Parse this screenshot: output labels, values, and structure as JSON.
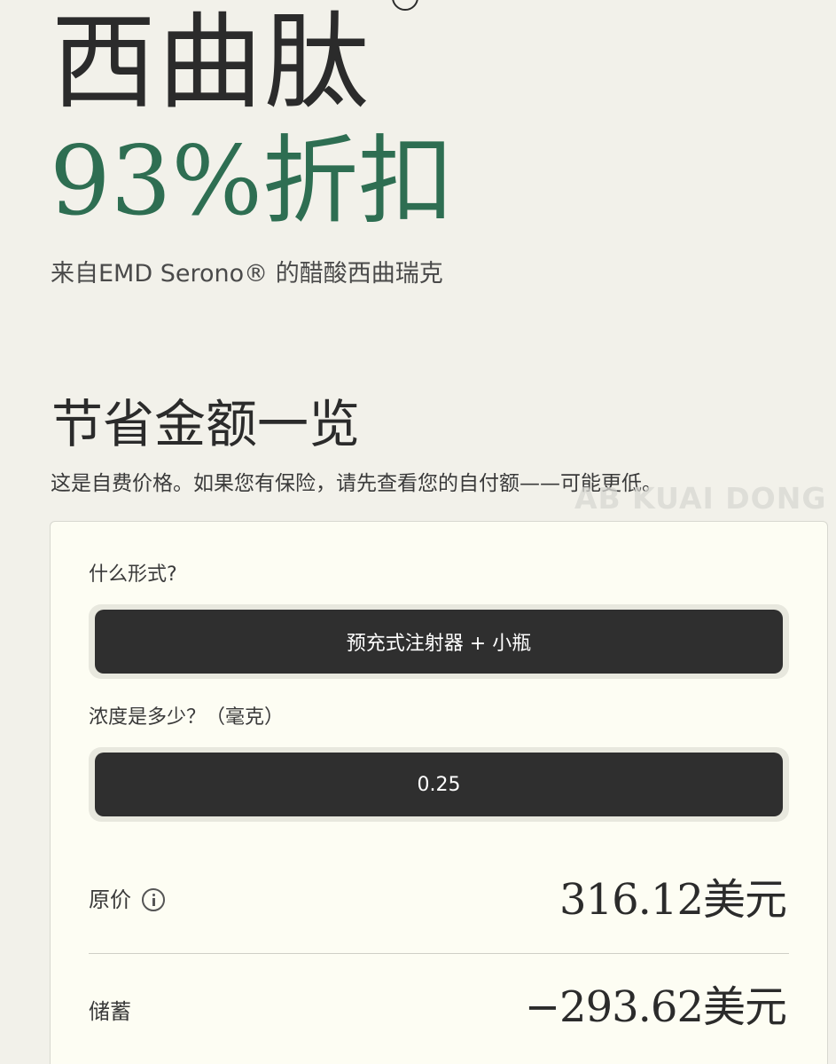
{
  "header": {
    "drug_name": "西曲肽",
    "discount": "93%折扣",
    "subtitle": "来自EMD Serono® 的醋酸西曲瑞克"
  },
  "summary": {
    "title": "节省金额一览",
    "note": "这是自费价格。如果您有保险，请先查看您的自付额——可能更低。"
  },
  "watermark": "AB KUAI DONG",
  "form": {
    "label": "什么形式?",
    "selected": "预充式注射器 + 小瓶"
  },
  "dose": {
    "label": "浓度是多少？（毫克）",
    "selected": "0.25"
  },
  "price": {
    "label": "原价",
    "icon": "info-icon",
    "value": "316.12美元"
  },
  "savings": {
    "label": "储蓄",
    "value": "−293.62美元"
  }
}
